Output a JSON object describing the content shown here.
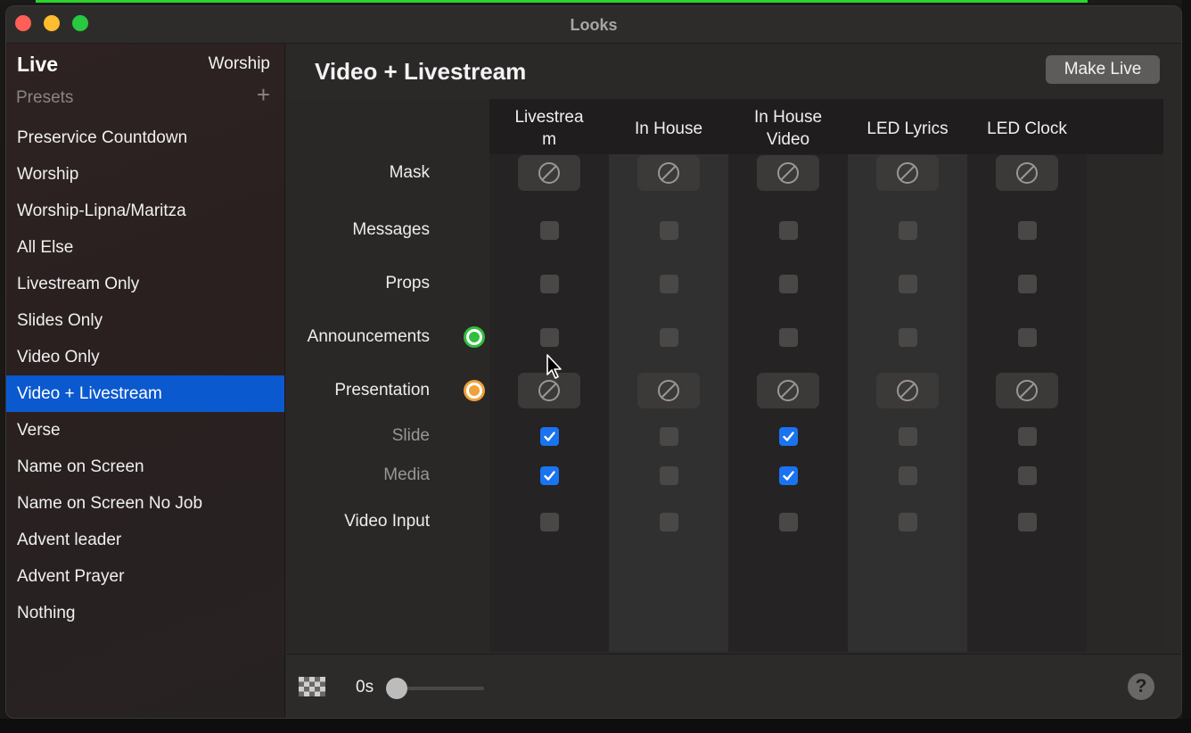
{
  "window": {
    "title": "Looks"
  },
  "sidebar": {
    "live_label": "Live",
    "live_value": "Worship",
    "presets_label": "Presets",
    "add_icon": "plus-icon",
    "items": [
      {
        "label": "Preservice Countdown",
        "selected": false
      },
      {
        "label": "Worship",
        "selected": false
      },
      {
        "label": "Worship-Lipna/Maritza",
        "selected": false
      },
      {
        "label": "All Else",
        "selected": false
      },
      {
        "label": "Livestream Only",
        "selected": false
      },
      {
        "label": "Slides Only",
        "selected": false
      },
      {
        "label": "Video Only",
        "selected": false
      },
      {
        "label": "Video + Livestream",
        "selected": true
      },
      {
        "label": "Verse",
        "selected": false
      },
      {
        "label": "Name on Screen",
        "selected": false
      },
      {
        "label": "Name on Screen No Job",
        "selected": false
      },
      {
        "label": "Advent leader",
        "selected": false
      },
      {
        "label": "Advent Prayer",
        "selected": false
      },
      {
        "label": "Nothing",
        "selected": false
      }
    ]
  },
  "main": {
    "title": "Video + Livestream",
    "make_live_label": "Make Live",
    "columns": [
      "Livestrea\nm",
      "In House",
      "In House\nVideo",
      "LED Lyrics",
      "LED Clock"
    ],
    "rows": [
      {
        "label": "Mask",
        "kind": "none",
        "sub": false
      },
      {
        "label": "Messages",
        "kind": "check",
        "values": [
          false,
          false,
          false,
          false,
          false
        ],
        "sub": false
      },
      {
        "label": "Props",
        "kind": "check",
        "values": [
          false,
          false,
          false,
          false,
          false
        ],
        "sub": false
      },
      {
        "label": "Announcements",
        "kind": "check",
        "values": [
          false,
          false,
          false,
          false,
          false
        ],
        "sub": false,
        "dot": "green"
      },
      {
        "label": "Presentation",
        "kind": "none",
        "sub": false,
        "dot": "orange"
      },
      {
        "label": "Slide",
        "kind": "check",
        "values": [
          true,
          false,
          true,
          false,
          false
        ],
        "sub": true
      },
      {
        "label": "Media",
        "kind": "check",
        "values": [
          true,
          false,
          true,
          false,
          false
        ],
        "sub": true
      },
      {
        "label": "Video Input",
        "kind": "check",
        "values": [
          false,
          false,
          false,
          false,
          false
        ],
        "sub": false
      }
    ]
  },
  "footer": {
    "transition_icon": "checkerboard-icon",
    "duration": "0s",
    "help_label": "?"
  },
  "colors": {
    "accent": "#0b59cf",
    "checked": "#1a73f0",
    "announcements_dot": "#2fbf3d",
    "presentation_dot": "#f0a13a"
  }
}
